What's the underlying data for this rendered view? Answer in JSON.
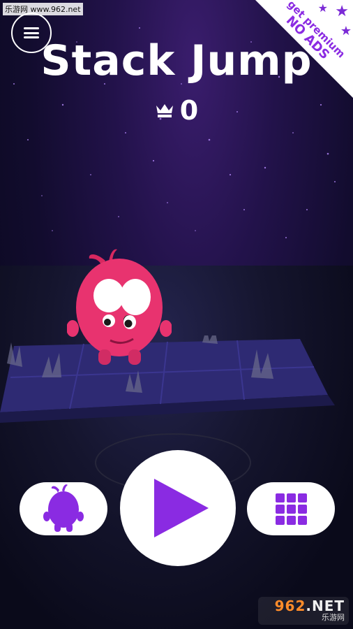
{
  "watermark_top": "乐游网 www.962.net",
  "title": "Stack Jump",
  "score": {
    "value": "0"
  },
  "premium": {
    "line1": "get premium",
    "line2": "NO ADS"
  },
  "watermark_bottom": {
    "brand_a": "962",
    "brand_b": ".NET",
    "sub": "乐游网"
  },
  "colors": {
    "accent": "#8a2be2",
    "character": "#e8336f",
    "background": "#0b0a1e"
  },
  "icons": [
    "menu-icon",
    "crown-icon",
    "character-icon",
    "play-icon",
    "level-grid-icon"
  ]
}
